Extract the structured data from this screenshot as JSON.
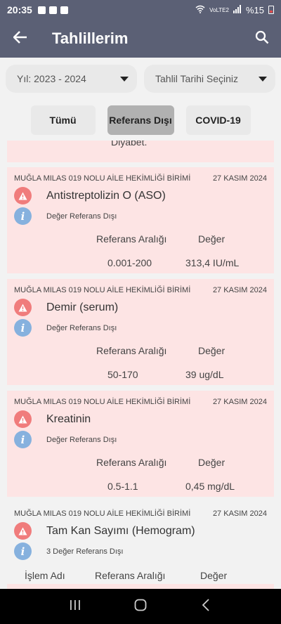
{
  "status_bar": {
    "time": "20:35",
    "network": "VoLTE2",
    "battery": "%15"
  },
  "app_bar": {
    "title": "Tahlillerim"
  },
  "filters": {
    "year": "Yıl: 2023 - 2024",
    "date": "Tahlil Tarihi Seçiniz"
  },
  "tabs": [
    "Tümü",
    "Referans Dışı",
    "COVID-19"
  ],
  "partial_card": {
    "text": "Diyabet."
  },
  "headers": {
    "ref": "Referans Aralığı",
    "value": "Değer",
    "process": "İşlem Adı"
  },
  "cards": [
    {
      "facility": "MUĞLA MILAS 019 NOLU AİLE HEKİMLİĞİ BİRİMİ",
      "date": "27 KASIM 2024",
      "test": "Antistreptolizin O (ASO)",
      "status": "Değer Referans Dışı",
      "ref": "0.001-200",
      "value": "313,4 IU/mL"
    },
    {
      "facility": "MUĞLA MILAS 019 NOLU AİLE HEKİMLİĞİ BİRİMİ",
      "date": "27 KASIM 2024",
      "test": "Demir (serum)",
      "status": "Değer Referans Dışı",
      "ref": "50-170",
      "value": "39 ug/dL"
    },
    {
      "facility": "MUĞLA MILAS 019 NOLU AİLE HEKİMLİĞİ BİRİMİ",
      "date": "27 KASIM 2024",
      "test": "Kreatinin",
      "status": "Değer Referans Dışı",
      "ref": "0.5-1.1",
      "value": "0,45 mg/dL"
    },
    {
      "facility": "MUĞLA MILAS 019 NOLU AİLE HEKİMLİĞİ BİRİMİ",
      "date": "27 KASIM 2024",
      "test": "Tam Kan Sayımı (Hemogram)",
      "status": "3 Değer Referans Dışı"
    }
  ],
  "colors": {
    "primary": "#5b6075",
    "card_bg": "#fde4e4",
    "warn": "#f07c7c",
    "info": "#86b1de"
  }
}
